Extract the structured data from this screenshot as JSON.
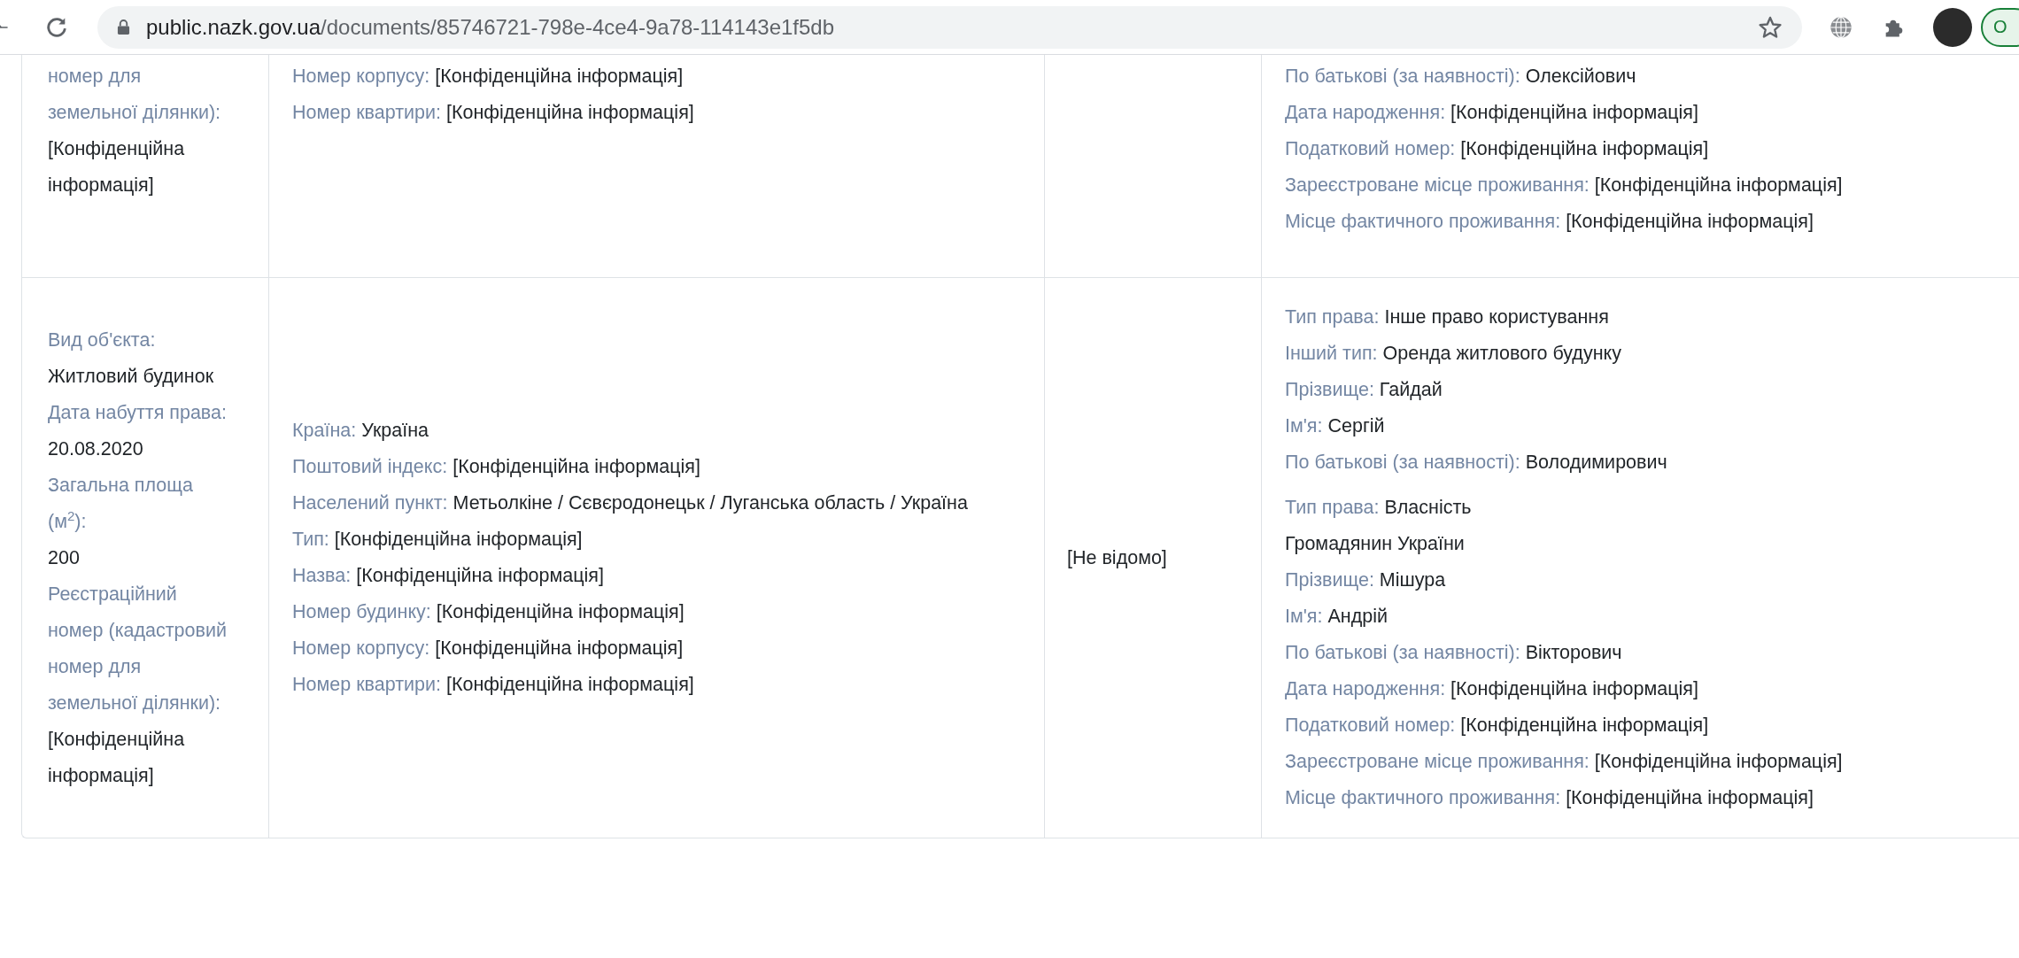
{
  "browser": {
    "url": {
      "host": "public.nazk.gov.ua",
      "path": "/documents/85746721-798e-4ce4-9a78-114143e1f5db"
    },
    "edge_button": "O"
  },
  "table": {
    "rows": [
      {
        "object": [
          {
            "label": "номер для земельної ділянки):"
          },
          {
            "value": "[Конфіденційна інформація]"
          }
        ],
        "address": [
          {
            "label": "Номер корпусу:",
            "value": "[Конфіденційна інформація]"
          },
          {
            "label": "Номер квартири:",
            "value": "[Конфіденційна інформація]"
          }
        ],
        "rights": [
          [
            {
              "label": "По батькові (за наявності):",
              "value": "Олексійович"
            },
            {
              "label": "Дата народження:",
              "value": "[Конфіденційна інформація]"
            },
            {
              "label": "Податковий номер:",
              "value": "[Конфіденційна інформація]"
            },
            {
              "label": "Зареєстроване місце проживання:",
              "value": "[Конфіденційна інформація]"
            },
            {
              "label": "Місце фактичного проживання:",
              "value": "[Конфіденційна інформація]"
            }
          ]
        ]
      },
      {
        "object": [
          {
            "label": "Вид об'єкта:"
          },
          {
            "value": "Житловий будинок"
          },
          {
            "label": "Дата набуття права:"
          },
          {
            "value": "20.08.2020"
          },
          {
            "label": "Загальна площа (м$^{2}$):"
          },
          {
            "value": "200"
          },
          {
            "label": "Реєстраційний номер (кадастровий номер для земельної ділянки):"
          },
          {
            "value": "[Конфіденційна інформація]"
          }
        ],
        "address": [
          {
            "label": "Країна:",
            "value": "Україна"
          },
          {
            "label": "Поштовий індекс:",
            "value": "[Конфіденційна інформація]"
          },
          {
            "label": "Населений пункт:",
            "value": "Метьолкіне / Сєвєродонецьк / Луганська область / Україна"
          },
          {
            "label": "Тип:",
            "value": "[Конфіденційна інформація]"
          },
          {
            "label": "Назва:",
            "value": "[Конфіденційна інформація]"
          },
          {
            "label": "Номер будинку:",
            "value": "[Конфіденційна інформація]"
          },
          {
            "label": "Номер корпусу:",
            "value": "[Конфіденційна інформація]"
          },
          {
            "label": "Номер квартири:",
            "value": "[Конфіденційна інформація]"
          }
        ],
        "column_3": "[Не відомо]",
        "rights": [
          [
            {
              "label": "Тип права:",
              "value": "Інше право користування"
            },
            {
              "label": "Інший тип:",
              "value": "Оренда житлового будунку"
            },
            {
              "label": "Прізвище:",
              "value": "Гайдай"
            },
            {
              "label": "Ім'я:",
              "value": "Сергій"
            },
            {
              "label": "По батькові (за наявності):",
              "value": "Володимирович"
            }
          ],
          [
            {
              "label": "Тип права:",
              "value": "Власність"
            },
            {
              "value": "Громадянин України"
            },
            {
              "label": "Прізвище:",
              "value": "Мішура"
            },
            {
              "label": "Ім'я:",
              "value": "Андрій"
            },
            {
              "label": "По батькові (за наявності):",
              "value": "Вікторович"
            },
            {
              "label": "Дата народження:",
              "value": "[Конфіденційна інформація]"
            },
            {
              "label": "Податковий номер:",
              "value": "[Конфіденційна інформація]"
            },
            {
              "label": "Зареєстроване місце проживання:",
              "value": "[Конфіденційна інформація]"
            },
            {
              "label": "Місце фактичного проживання:",
              "value": "[Конфіденційна інформація]"
            }
          ]
        ]
      }
    ]
  }
}
